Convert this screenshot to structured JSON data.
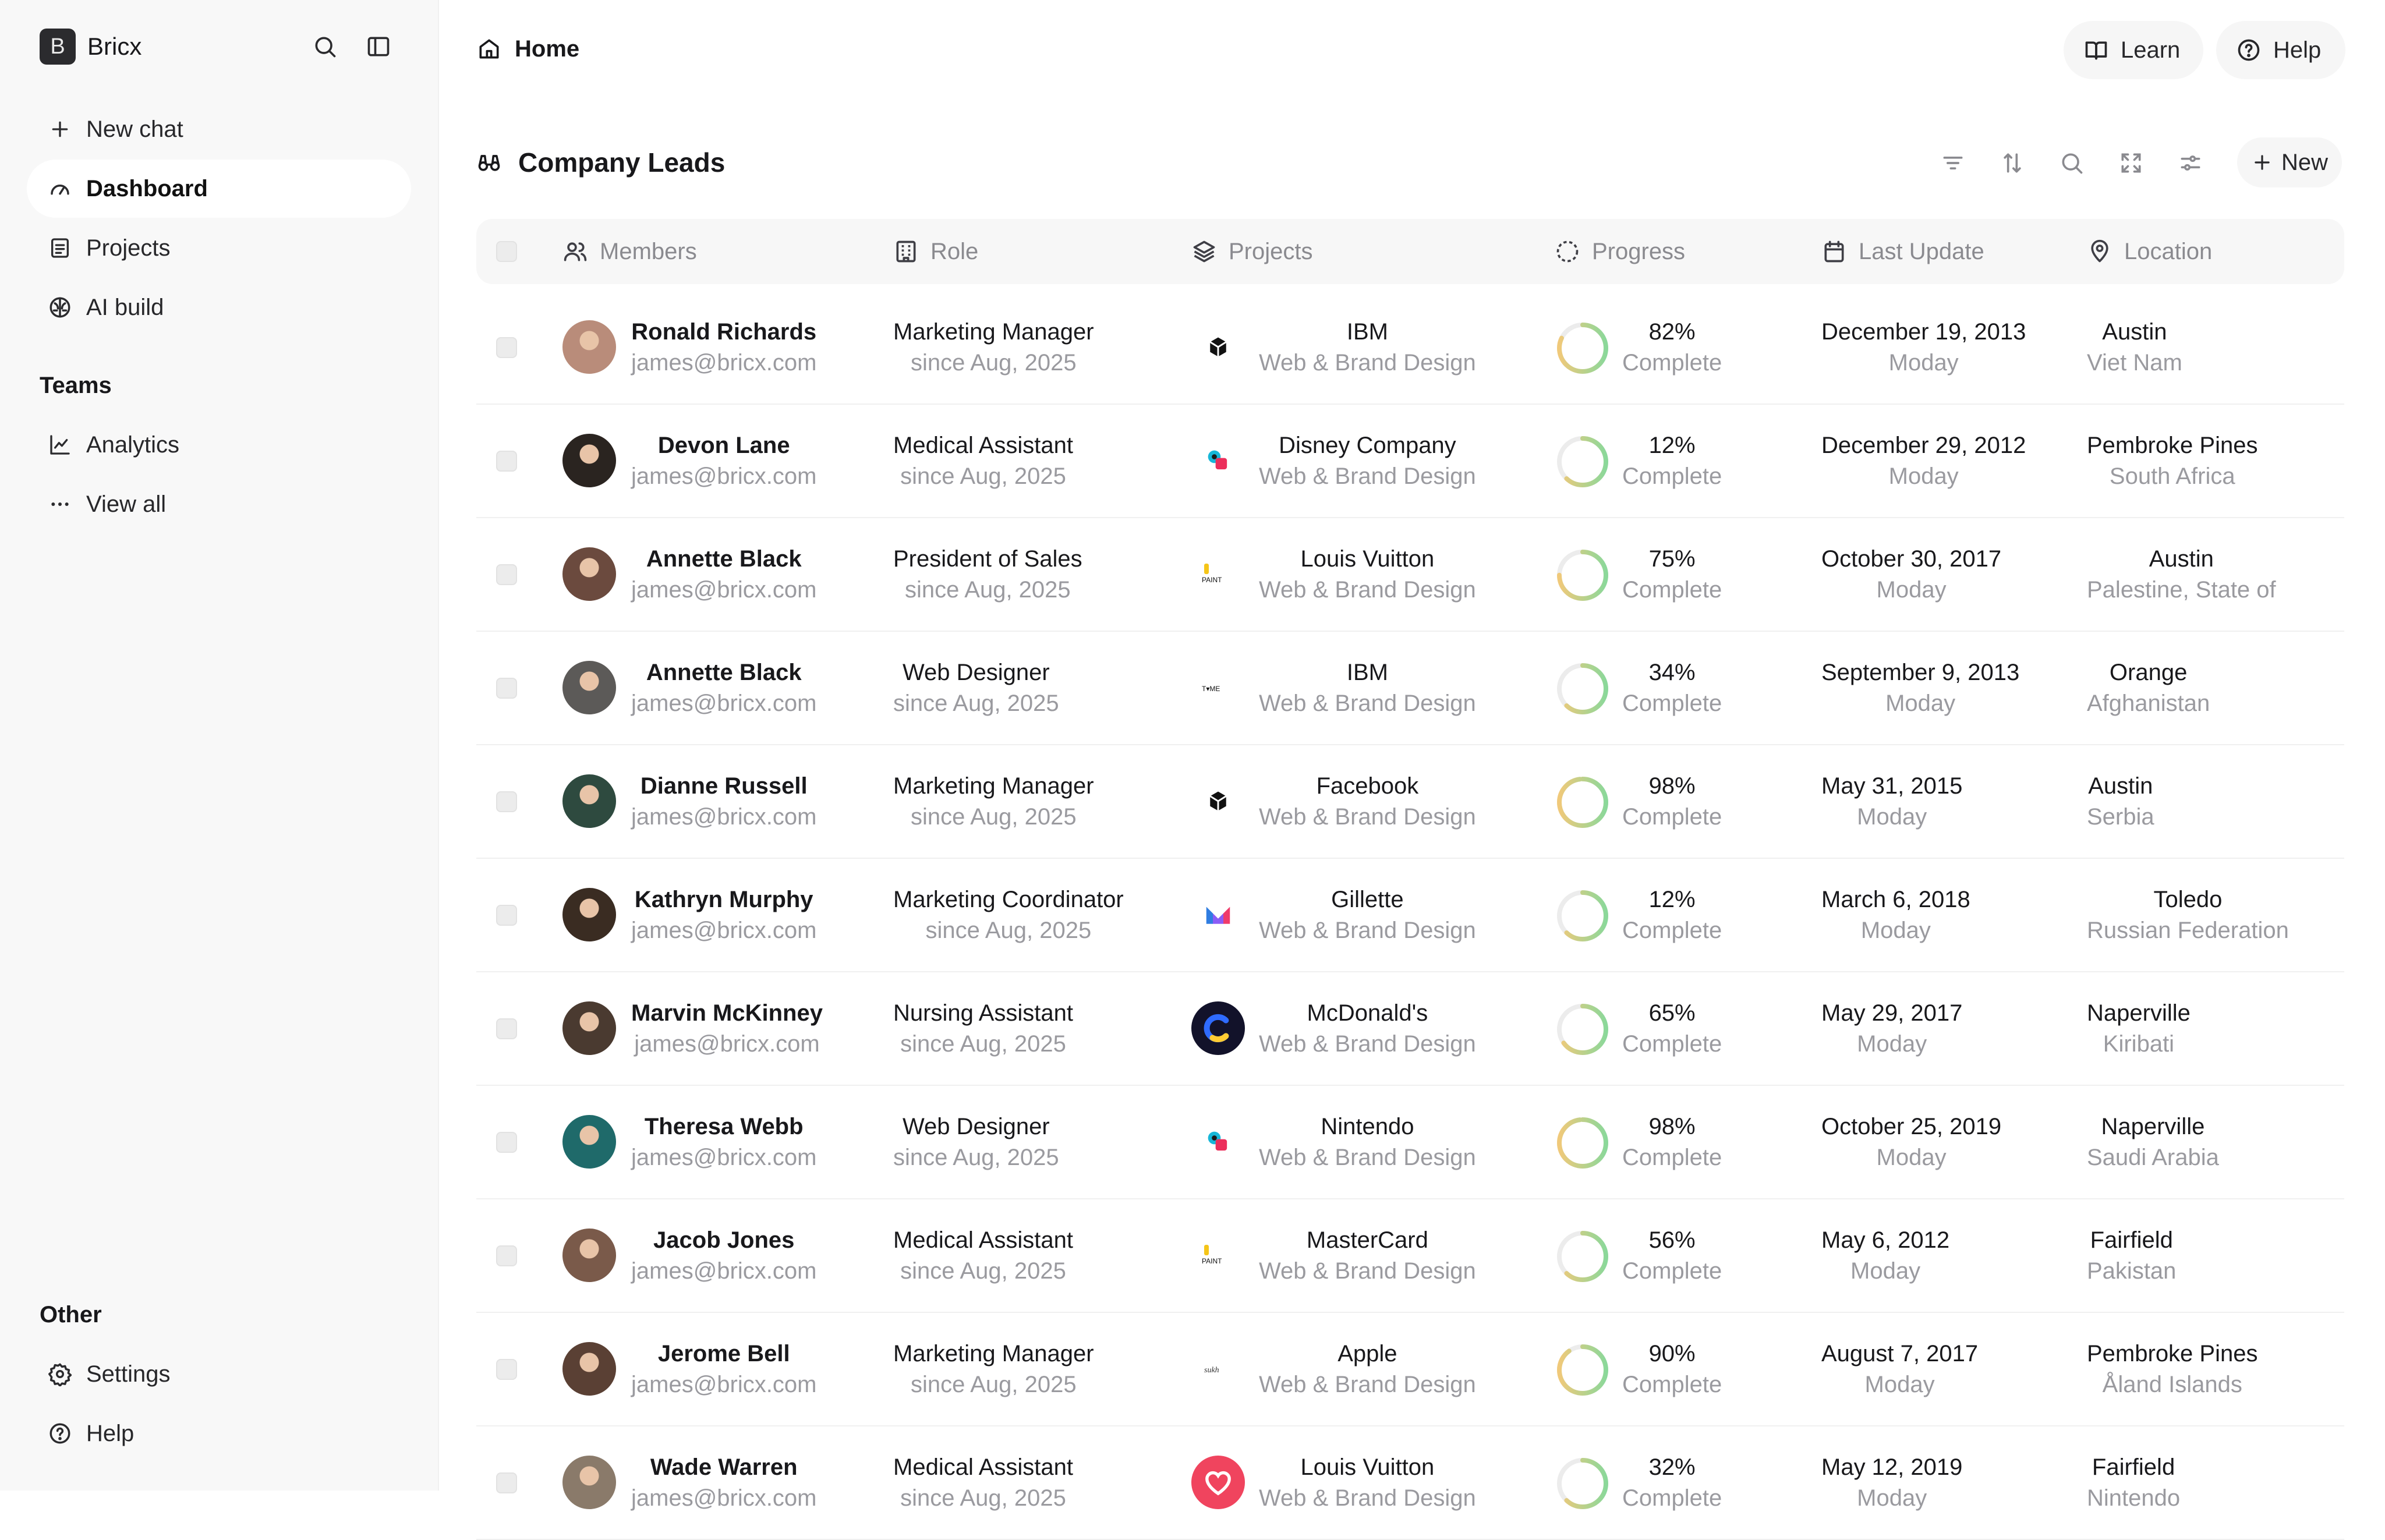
{
  "sidebar": {
    "brand_initial": "B",
    "brand_name": "Bricx",
    "nav": [
      {
        "label": "New chat",
        "icon": "plus-icon"
      },
      {
        "label": "Dashboard",
        "icon": "gauge-icon",
        "active": true
      },
      {
        "label": "Projects",
        "icon": "document-icon"
      },
      {
        "label": "AI build",
        "icon": "brain-icon"
      }
    ],
    "teams_title": "Teams",
    "teams": [
      {
        "label": "Analytics",
        "icon": "line-chart-icon"
      },
      {
        "label": "View all",
        "icon": "dots-icon"
      }
    ],
    "other_title": "Other",
    "other": [
      {
        "label": "Settings",
        "icon": "gear-icon"
      },
      {
        "label": "Help",
        "icon": "help-circle-icon"
      }
    ]
  },
  "header": {
    "breadcrumb": "Home",
    "learn_label": "Learn",
    "help_label": "Help"
  },
  "section": {
    "title": "Company Leads",
    "new_label": "New"
  },
  "table": {
    "columns": {
      "members": "Members",
      "role": "Role",
      "projects": "Projects",
      "progress": "Progress",
      "last_update": "Last Update",
      "location": "Location"
    },
    "rows": [
      {
        "name": "Ronald Richards",
        "email": "james@bricx.com",
        "role": "Marketing Manager",
        "since": "since Aug, 2025",
        "project": "IBM",
        "project_type": "Web & Brand Design",
        "logo": "hexagon-logo",
        "progress": "82%",
        "progress_label": "Complete",
        "progress_value": 0.82,
        "date": "December 19, 2013",
        "day": "Moday",
        "city": "Austin",
        "country": "Viet Nam",
        "avatar_color": "#b98c7a"
      },
      {
        "name": "Devon Lane",
        "email": "james@bricx.com",
        "role": "Medical Assistant",
        "since": "since Aug, 2025",
        "project": "Disney Company",
        "project_type": "Web & Brand Design",
        "logo": "overlap-logo",
        "progress": "12%",
        "progress_label": "Complete",
        "progress_value": 0.12,
        "date": "December 29, 2012",
        "day": "Moday",
        "city": "Pembroke Pines",
        "country": "South Africa",
        "avatar_color": "#2a2420"
      },
      {
        "name": "Annette Black",
        "email": "james@bricx.com",
        "role": "President of Sales",
        "since": "since Aug, 2025",
        "project": "Louis Vuitton",
        "project_type": "Web & Brand Design",
        "logo": "paint-logo",
        "progress": "75%",
        "progress_label": "Complete",
        "progress_value": 0.75,
        "date": "October 30, 2017",
        "day": "Moday",
        "city": "Austin",
        "country": "Palestine, State of",
        "avatar_color": "#6b4a3e"
      },
      {
        "name": "Annette Black",
        "email": "james@bricx.com",
        "role": "Web Designer",
        "since": "since Aug, 2025",
        "project": "IBM",
        "project_type": "Web & Brand Design",
        "logo": "tyme-logo",
        "progress": "34%",
        "progress_label": "Complete",
        "progress_value": 0.34,
        "date": "September 9, 2013",
        "day": "Moday",
        "city": "Orange",
        "country": "Afghanistan",
        "avatar_color": "#5c5a58"
      },
      {
        "name": "Dianne Russell",
        "email": "james@bricx.com",
        "role": "Marketing Manager",
        "since": "since Aug, 2025",
        "project": "Facebook",
        "project_type": "Web & Brand Design",
        "logo": "hexagon-logo",
        "progress": "98%",
        "progress_label": "Complete",
        "progress_value": 0.98,
        "date": "May 31, 2015",
        "day": "Moday",
        "city": "Austin",
        "country": "Serbia",
        "avatar_color": "#2e4a3f"
      },
      {
        "name": "Kathryn Murphy",
        "email": "james@bricx.com",
        "role": "Marketing Coordinator",
        "since": "since Aug, 2025",
        "project": "Gillette",
        "project_type": "Web & Brand Design",
        "logo": "m-logo",
        "progress": "12%",
        "progress_label": "Complete",
        "progress_value": 0.12,
        "date": "March 6, 2018",
        "day": "Moday",
        "city": "Toledo",
        "country": "Russian Federation",
        "avatar_color": "#3a2c22"
      },
      {
        "name": "Marvin McKinney",
        "email": "james@bricx.com",
        "role": "Nursing Assistant",
        "since": "since Aug, 2025",
        "project": "McDonald's",
        "project_type": "Web & Brand Design",
        "logo": "c-logo",
        "progress": "65%",
        "progress_label": "Complete",
        "progress_value": 0.65,
        "date": "May 29, 2017",
        "day": "Moday",
        "city": "Naperville",
        "country": "Kiribati",
        "avatar_color": "#4a3a30"
      },
      {
        "name": "Theresa Webb",
        "email": "james@bricx.com",
        "role": "Web Designer",
        "since": "since Aug, 2025",
        "project": "Nintendo",
        "project_type": "Web & Brand Design",
        "logo": "overlap-logo",
        "progress": "98%",
        "progress_label": "Complete",
        "progress_value": 0.98,
        "date": "October 25, 2019",
        "day": "Moday",
        "city": "Naperville",
        "country": "Saudi Arabia",
        "avatar_color": "#1f6a6a"
      },
      {
        "name": "Jacob Jones",
        "email": "james@bricx.com",
        "role": "Medical Assistant",
        "since": "since Aug, 2025",
        "project": "MasterCard",
        "project_type": "Web & Brand Design",
        "logo": "paint-logo",
        "progress": "56%",
        "progress_label": "Complete",
        "progress_value": 0.56,
        "date": "May 6, 2012",
        "day": "Moday",
        "city": "Fairfield",
        "country": "Pakistan",
        "avatar_color": "#7a5a4a"
      },
      {
        "name": "Jerome Bell",
        "email": "james@bricx.com",
        "role": "Marketing Manager",
        "since": "since Aug, 2025",
        "project": "Apple",
        "project_type": "Web & Brand Design",
        "logo": "script-logo",
        "progress": "90%",
        "progress_label": "Complete",
        "progress_value": 0.9,
        "date": "August 7, 2017",
        "day": "Moday",
        "city": "Pembroke Pines",
        "country": "Åland Islands",
        "avatar_color": "#5a4034"
      },
      {
        "name": "Wade Warren",
        "email": "james@bricx.com",
        "role": "Medical Assistant",
        "since": "since Aug, 2025",
        "project": "Louis Vuitton",
        "project_type": "Web & Brand Design",
        "logo": "heart-logo",
        "progress": "32%",
        "progress_label": "Complete",
        "progress_value": 0.32,
        "date": "May 12, 2019",
        "day": "Moday",
        "city": "Fairfield",
        "country": "Nintendo",
        "avatar_color": "#8a7a6a"
      }
    ]
  },
  "colors": {
    "ring_track": "#ececec",
    "ring_start": "#f0c97a",
    "ring_end": "#8bd89a",
    "sidebar_bg": "#f8f8f8"
  }
}
